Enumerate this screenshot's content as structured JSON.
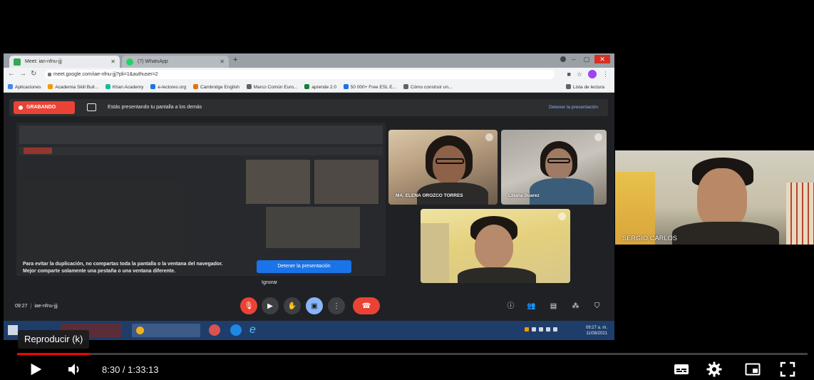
{
  "browser": {
    "tabs": [
      {
        "label": "Meet: ian-nfnu-jjj",
        "icon_color": "#34a853"
      },
      {
        "label": "(7) WhatsApp",
        "icon_color": "#25d366"
      }
    ],
    "url": "meet.google.com/iae-nfnu-jjj?pli=1&authuser=2",
    "bookmarks": [
      {
        "label": "Aplicaciones",
        "color": "#4285f4"
      },
      {
        "label": "Academia Skill Buil...",
        "color": "#f29900"
      },
      {
        "label": "Khan Academy",
        "color": "#14bf96"
      },
      {
        "label": "e-lectores.org",
        "color": "#1a73e8"
      },
      {
        "label": "Cambridge English",
        "color": "#e37400"
      },
      {
        "label": "Marco Común Euro...",
        "color": "#5f6368"
      },
      {
        "label": "aprende 2.0",
        "color": "#188038"
      },
      {
        "label": "50 000+ Free ESL E...",
        "color": "#1a73e8"
      },
      {
        "label": "Cómo construir un...",
        "color": "#5f6368"
      }
    ],
    "reading_list": "Lista de lectura"
  },
  "meet": {
    "recording_label": "GRABANDO",
    "presenting_text": "Estás presentando tu pantalla a los demás",
    "stop_presenting_link": "Detener la presentación",
    "duplication_warning": "Para evitar la duplicación, no compartas toda la pantalla o la ventana del navegador. Mejor comparte solamente una pestaña o una ventana diferente.",
    "stop_presenting_button": "Detener la presentación",
    "ignore_label": "Ignorar",
    "time": "09:27",
    "meeting_code": "iae-nfnu-jjj",
    "participants": [
      {
        "name": "MA. ELENA OROZCO TORRES"
      },
      {
        "name": "Liliana Suarez"
      },
      {
        "name": ""
      }
    ],
    "controls": {
      "mic": "mic-off-icon",
      "camera": "camera-icon",
      "hand": "raise-hand-icon",
      "present": "present-icon",
      "more": "more-options-icon",
      "hangup": "hang-up-icon"
    }
  },
  "taskbar": {
    "clock_time": "09:27 a. m.",
    "clock_date": "11/08/2021"
  },
  "camera_overlay": {
    "name": "SERGIO CARLOS"
  },
  "player": {
    "tooltip": "Reproducir (k)",
    "current_time": "8:30",
    "duration": "1:33:13",
    "time_display": "8:30 / 1:33:13",
    "progress_fraction": 0.0912,
    "accent_color": "#ff0000"
  }
}
